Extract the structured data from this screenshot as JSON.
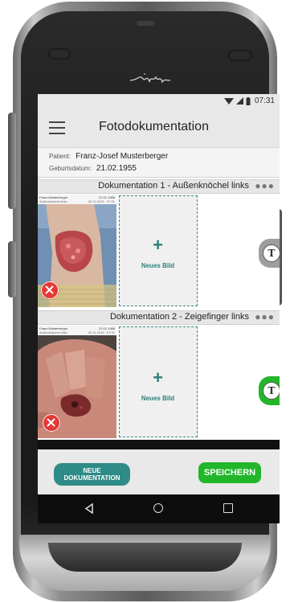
{
  "device": {
    "brand_logo_icon": "signature-logo-icon"
  },
  "status_bar": {
    "time": "07:31",
    "icons": [
      "wifi-icon",
      "signal-icon",
      "battery-icon"
    ]
  },
  "app_bar": {
    "title": "Fotodokumentation",
    "menu_icon": "hamburger-menu-icon"
  },
  "patient": {
    "patient_label": "Patient:",
    "patient_name": "Franz-Josef Musterberger",
    "dob_label": "Geburtsdatum:",
    "dob_value": "21.02.1955"
  },
  "documentations": [
    {
      "title": "Dokumentation 1 - Außenknöchel links",
      "more_icon": "more-dots-icon",
      "photo": {
        "header_name": "Franz Musterberger",
        "header_sub": "Außenknöchel links",
        "header_date": "21.01.1986",
        "header_date2": "02.11.2019 · 07:31"
      },
      "new_image_label": "Neues Bild",
      "new_image_plus": "+",
      "t_label": "T",
      "t_tab_color": "#9e9e9e"
    },
    {
      "title": "Dokumentation 2 - Zeigefinger links",
      "more_icon": "more-dots-icon",
      "photo": {
        "header_name": "Franz Musterberger",
        "header_sub": "Außenknöchel links",
        "header_date": "21.01.1986",
        "header_date2": "02.11.2019 · 07:31"
      },
      "new_image_label": "Neues Bild",
      "new_image_plus": "+",
      "t_label": "T",
      "t_tab_color": "#22b62a"
    }
  ],
  "actions": {
    "new_doc_line1": "NEUE",
    "new_doc_line2": "DOKUMENTATION",
    "save": "SPEICHERN"
  },
  "nav": {
    "icons": [
      "back-icon",
      "home-icon",
      "recents-icon"
    ]
  },
  "colors": {
    "teal": "#2e8b87",
    "green": "#22b62a",
    "delete_red": "#e53935"
  }
}
